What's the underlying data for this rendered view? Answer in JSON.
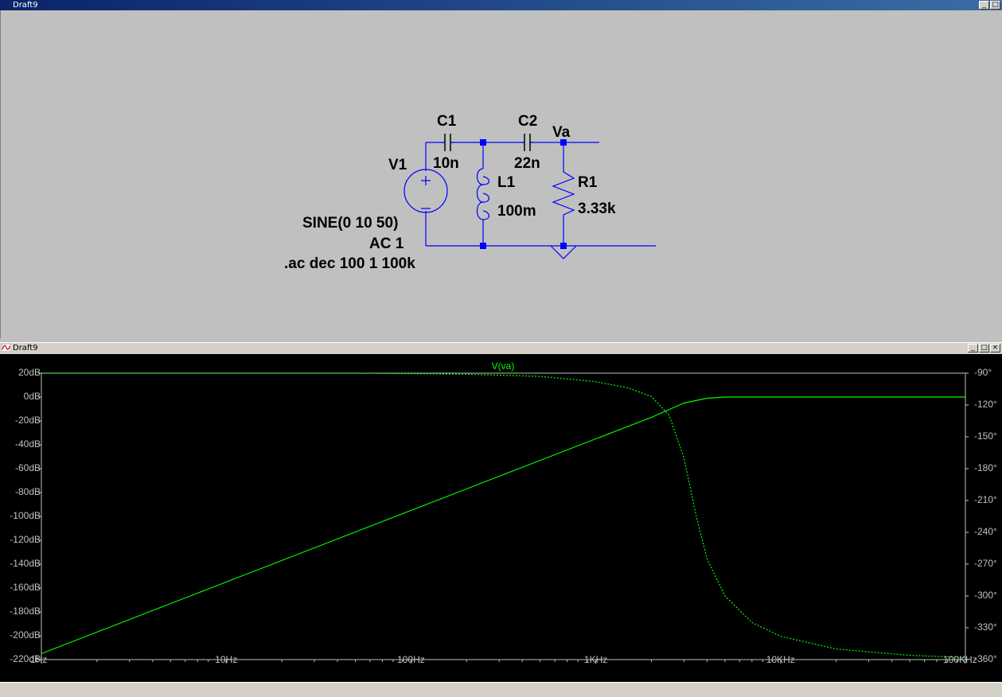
{
  "schematic_window": {
    "title": "Draft9"
  },
  "schematic": {
    "v1_name": "V1",
    "v1_value": "SINE(0 10 50)",
    "v1_ac": "AC 1",
    "directive": ".ac dec 100 1 100k",
    "c1_name": "C1",
    "c1_value": "10n",
    "c2_name": "C2",
    "c2_value": "22n",
    "l1_name": "L1",
    "l1_value": "100m",
    "r1_name": "R1",
    "r1_value": "3.33k",
    "net_label": "Va"
  },
  "plot_window": {
    "title": "Draft9",
    "btn_min": "_",
    "btn_max": "□",
    "btn_close": "×"
  },
  "chart_data": {
    "type": "line",
    "title": "V(va)",
    "x_scale": "log",
    "xlim": [
      1,
      100000
    ],
    "x_ticks": [
      "1Hz",
      "10Hz",
      "100Hz",
      "1KHz",
      "10KHz",
      "100KHz"
    ],
    "y_left_ticks": [
      "20dB",
      "0dB",
      "-20dB",
      "-40dB",
      "-60dB",
      "-80dB",
      "-100dB",
      "-120dB",
      "-140dB",
      "-160dB",
      "-180dB",
      "-200dB",
      "-220dB"
    ],
    "y_right_ticks": [
      "-90°",
      "-120°",
      "-150°",
      "-180°",
      "-210°",
      "-240°",
      "-270°",
      "-300°",
      "-330°",
      "-360°"
    ],
    "ylim_left": [
      -220,
      20
    ],
    "ylim_right": [
      -360,
      -90
    ],
    "series": [
      {
        "name": "V(va)",
        "style": "solid",
        "axis": "left",
        "color": "#00ff00",
        "x": [
          1,
          10,
          100,
          1000,
          2000,
          3000,
          4000,
          5000,
          7000,
          10000,
          100000
        ],
        "y": [
          -215,
          -155,
          -95,
          -35,
          -17,
          -5,
          -1,
          0,
          0,
          0,
          0
        ]
      },
      {
        "name": "V(va)",
        "style": "dashed",
        "axis": "right",
        "color": "#00ff00",
        "x": [
          1,
          10,
          50,
          100,
          200,
          500,
          1000,
          1500,
          2000,
          2500,
          3000,
          3500,
          4000,
          5000,
          7000,
          10000,
          20000,
          50000,
          100000
        ],
        "y": [
          -90,
          -90,
          -90,
          -90.5,
          -91,
          -93,
          -98,
          -104,
          -112,
          -130,
          -170,
          -225,
          -265,
          -300,
          -325,
          -338,
          -350,
          -356,
          -358
        ]
      }
    ]
  }
}
